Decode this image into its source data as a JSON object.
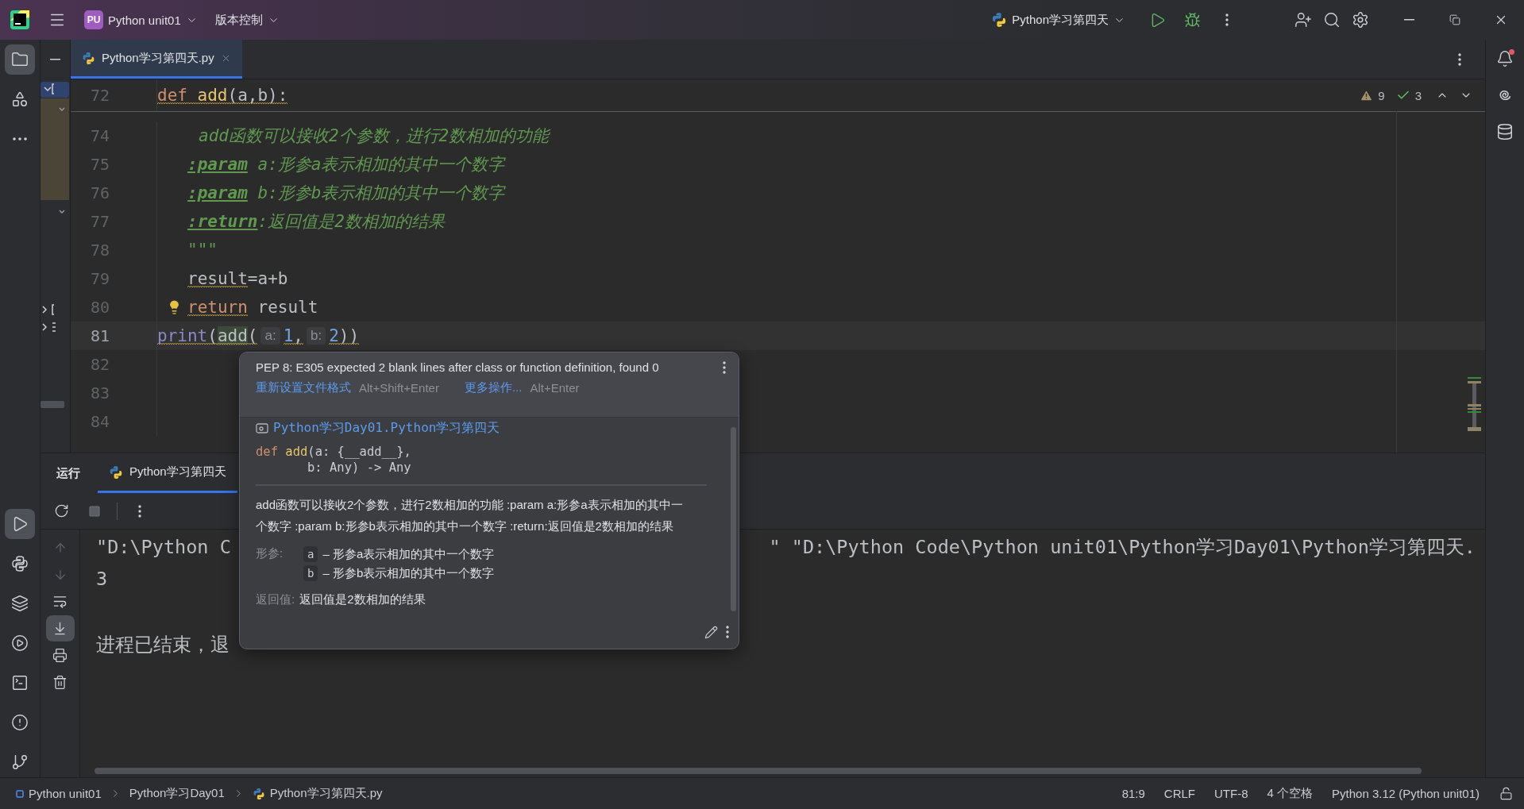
{
  "title_bar": {
    "project_badge": "PU",
    "project": "Python unit01",
    "vcs": "版本控制",
    "run_config": "Python学习第四天"
  },
  "left_toolbar": {
    "top": [
      {
        "kind": "project",
        "selected": true
      },
      {
        "kind": "structure",
        "selected": false
      },
      {
        "kind": "more",
        "selected": false
      }
    ],
    "bottom": [
      {
        "kind": "run",
        "selected": true
      },
      {
        "kind": "python_console",
        "selected": false
      },
      {
        "kind": "packages",
        "selected": false
      },
      {
        "kind": "services",
        "selected": false
      },
      {
        "kind": "terminal",
        "selected": false
      },
      {
        "kind": "problems",
        "selected": false
      },
      {
        "kind": "git",
        "selected": false
      }
    ]
  },
  "right_toolbar": {
    "notification_unread": true
  },
  "editor": {
    "tabs": [
      {
        "label": "Python学习第四天.py",
        "selected": true
      }
    ],
    "inspections": {
      "warnings": "9",
      "weak_warnings": "3"
    },
    "sticky_line": {
      "number": "72",
      "tokens": [
        {
          "text": "def",
          "kind": "keyword",
          "squiggly": true
        },
        {
          "text": " add",
          "kind": "function",
          "squiggly": true
        },
        {
          "text": "(a,b):",
          "kind": "plain",
          "squiggly": true
        }
      ]
    },
    "lines": [
      {
        "number": "74",
        "kind": "doc_open",
        "current": false,
        "intention": false,
        "tokens": [
          {
            "text": "add函数可以接收2个参数，进行2数相加的功能",
            "kind": "doc"
          }
        ]
      },
      {
        "number": "75",
        "kind": "body",
        "current": false,
        "intention": false,
        "tokens": [
          {
            "text": ":param",
            "kind": "doctag"
          },
          {
            "text": " a:形参a表示相加的其中一个数字",
            "kind": "doc"
          }
        ]
      },
      {
        "number": "76",
        "kind": "body",
        "current": false,
        "intention": false,
        "tokens": [
          {
            "text": ":param",
            "kind": "doctag"
          },
          {
            "text": " b:形参b表示相加的其中一个数字",
            "kind": "doc"
          }
        ]
      },
      {
        "number": "77",
        "kind": "body",
        "current": false,
        "intention": false,
        "tokens": [
          {
            "text": ":return",
            "kind": "doctag"
          },
          {
            "text": ":返回值是2数相加的结果",
            "kind": "doc"
          }
        ]
      },
      {
        "number": "78",
        "kind": "body",
        "current": false,
        "intention": false,
        "tokens": [
          {
            "text": "\"\"\"",
            "kind": "doc"
          }
        ]
      },
      {
        "number": "79",
        "kind": "body",
        "current": false,
        "intention": false,
        "tokens": [
          {
            "text": "result",
            "kind": "plain",
            "squiggly": true
          },
          {
            "text": "=a+b",
            "kind": "plain",
            "squiggly": false
          }
        ]
      },
      {
        "number": "80",
        "kind": "body",
        "current": false,
        "intention": true,
        "tokens": [
          {
            "text": "return",
            "kind": "keyword",
            "squiggly": true
          },
          {
            "text": " result",
            "kind": "plain",
            "squiggly": false
          }
        ]
      },
      {
        "number": "81",
        "kind": "top",
        "current": true,
        "intention": false,
        "tokens": [
          {
            "text": "print",
            "kind": "builtin",
            "squiggly": true
          },
          {
            "text": "(",
            "kind": "plain",
            "squiggly": true
          },
          {
            "text": "add",
            "kind": "usage",
            "squiggly": true
          },
          {
            "text": "(",
            "kind": "plain",
            "squiggly": true
          },
          {
            "text": "a:",
            "kind": "hint",
            "squiggly": false
          },
          {
            "text": "1",
            "kind": "number",
            "squiggly": true
          },
          {
            "text": ",",
            "kind": "plain",
            "squiggly": true
          },
          {
            "text": "b:",
            "kind": "hint",
            "squiggly": false
          },
          {
            "text": "2",
            "kind": "number",
            "squiggly": true
          },
          {
            "text": "))",
            "kind": "plain",
            "squiggly": true
          }
        ]
      },
      {
        "number": "82",
        "kind": "top",
        "current": false,
        "intention": false
      },
      {
        "number": "83",
        "kind": "top",
        "current": false,
        "intention": false
      },
      {
        "number": "84",
        "kind": "top",
        "current": false,
        "intention": false
      }
    ]
  },
  "run_panel": {
    "title": "运行",
    "tabs": [
      {
        "label": "Python学习第四天",
        "selected": true
      }
    ],
    "console": [
      {
        "kind": "command",
        "segments": [
          "\"D:\\Python C",
          "\" \"D:\\Python Code\\Python unit01\\Python学习Day01\\Python学习第四天."
        ]
      },
      {
        "kind": "output",
        "segments": [
          "3"
        ]
      },
      {
        "kind": "exit",
        "segments": [
          "进程已结束，退"
        ]
      }
    ]
  },
  "quick_doc": {
    "problem": "PEP 8: E305 expected 2 blank lines after class or function definition, found 0",
    "actions": [
      {
        "label": "重新设置文件格式",
        "shortcut": "Alt+Shift+Enter"
      },
      {
        "label": "更多操作...",
        "shortcut": "Alt+Enter"
      }
    ],
    "location": "Python学习Day01.Python学习第四天",
    "signature": [
      {
        "kind": "first",
        "tokens": [
          {
            "text": "def",
            "kind": "keyword"
          },
          {
            "text": "add",
            "kind": "function"
          },
          {
            "text": "(a: {__add__},",
            "kind": "plain"
          }
        ]
      },
      {
        "kind": "continuation",
        "tokens": [
          {
            "text": "b: Any) -> Any",
            "kind": "plain"
          }
        ]
      }
    ],
    "description": "add函数可以接收2个参数，进行2数相加的功能 :param a:形参a表示相加的其中一个数字 :param b:形参b表示相加的其中一个数字 :return:返回值是2数相加的结果",
    "params_label": "形参:",
    "params": [
      {
        "name": "a",
        "text": "– 形参a表示相加的其中一个数字"
      },
      {
        "name": "b",
        "text": "– 形参b表示相加的其中一个数字"
      }
    ],
    "returns_label": "返回值:",
    "returns": "返回值是2数相加的结果"
  },
  "status_bar": {
    "breadcrumbs": [
      {
        "label": "Python unit01",
        "kind": "module"
      },
      {
        "label": "Python学习Day01",
        "kind": "folder"
      },
      {
        "label": "Python学习第四天.py",
        "kind": "python_file"
      }
    ],
    "position": "81:9",
    "line_separator": "CRLF",
    "encoding": "UTF-8",
    "indent": "4 个空格",
    "interpreter": "Python 3.12 (Python unit01)"
  }
}
